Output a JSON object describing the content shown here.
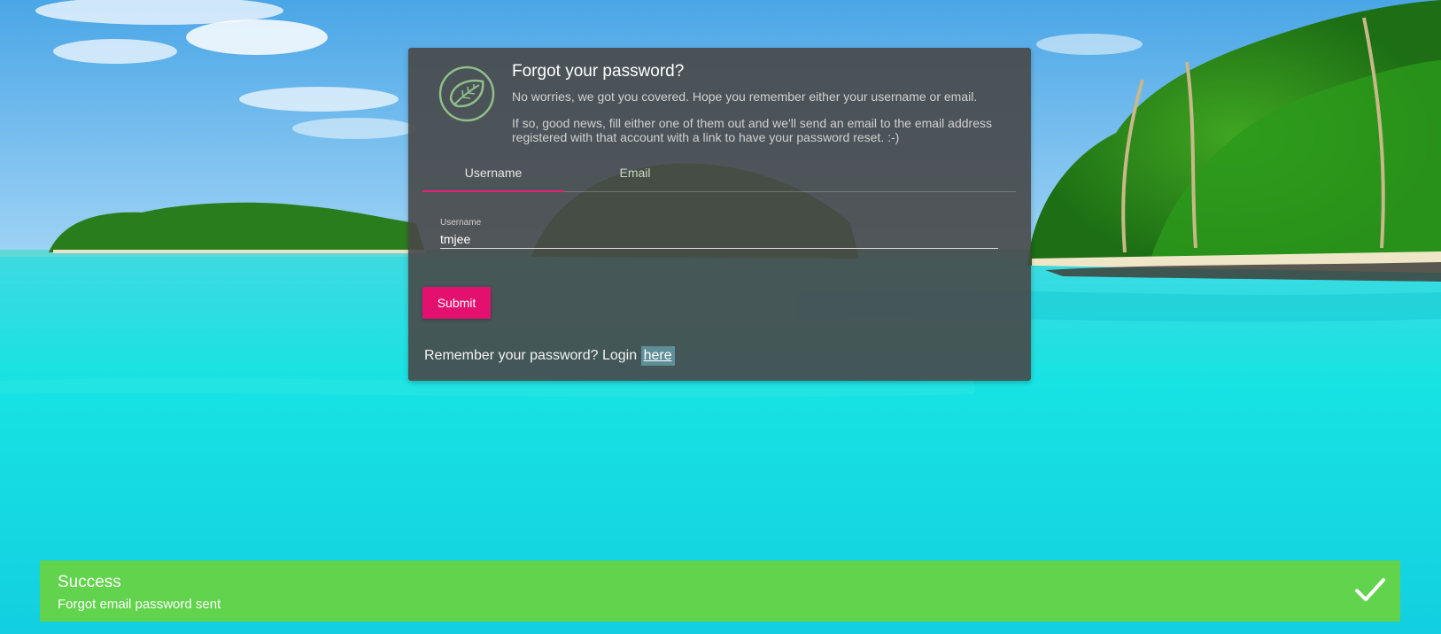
{
  "card": {
    "title": "Forgot your password?",
    "paragraph_1": "No worries, we got you covered. Hope you remember either your username or email.",
    "paragraph_2": "If so, good news, fill either one of them out and we'll send an email to the email address registered with that account with a link to have your password reset. :-)",
    "logo_icon": "leaf-icon"
  },
  "tabs": [
    {
      "label": "Username",
      "active": true
    },
    {
      "label": "Email",
      "active": false
    }
  ],
  "form": {
    "username_label": "Username",
    "username_value": "tmjee",
    "submit_label": "Submit"
  },
  "login_prompt": {
    "text": "Remember your password? Login",
    "link_text": "here"
  },
  "toast": {
    "title": "Success",
    "message": "Forgot email password sent",
    "icon": "checkmark-icon"
  },
  "colors": {
    "accent": "#e3106f",
    "success": "#62d34c",
    "link_highlight": "#5f8e99",
    "card_bg": "rgba(72,72,72,0.9)"
  }
}
